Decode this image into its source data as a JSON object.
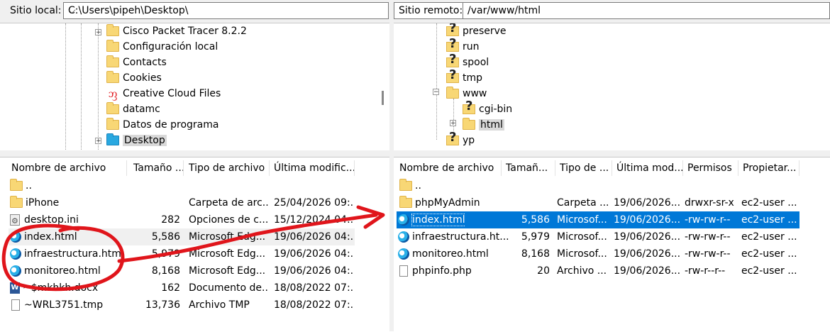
{
  "local": {
    "path_label": "Sitio local:",
    "path_value": "C:\\Users\\pipeh\\Desktop\\",
    "tree": [
      {
        "name": "Cisco Packet Tracer 8.2.2",
        "icon": "folder-icon"
      },
      {
        "name": "Configuración local",
        "icon": "shortcut-folder-icon"
      },
      {
        "name": "Contacts",
        "icon": "folder-icon"
      },
      {
        "name": "Cookies",
        "icon": "shortcut-folder-icon"
      },
      {
        "name": "Creative Cloud Files",
        "icon": "creative-cloud-icon"
      },
      {
        "name": "datamc",
        "icon": "folder-icon"
      },
      {
        "name": "Datos de programa",
        "icon": "shortcut-folder-icon"
      },
      {
        "name": "Desktop",
        "icon": "desktop-folder-icon"
      }
    ],
    "headers": [
      "Nombre de archivo",
      "Tamaño ...",
      "Tipo de archivo",
      "Última modific..."
    ],
    "files": [
      {
        "name": "..",
        "size": "",
        "type": "",
        "modified": "",
        "icon": "folder-icon"
      },
      {
        "name": "iPhone",
        "size": "",
        "type": "Carpeta de arc...",
        "modified": "25/04/2026 09:...",
        "icon": "folder-icon"
      },
      {
        "name": "desktop.ini",
        "size": "282",
        "type": "Opciones de c...",
        "modified": "15/12/2024 04:...",
        "icon": "settings-file-icon"
      },
      {
        "name": "index.html",
        "size": "5,586",
        "type": "Microsoft Edg...",
        "modified": "19/06/2026 04:...",
        "icon": "edge-icon"
      },
      {
        "name": "infraestructura.html",
        "size": "5,979",
        "type": "Microsoft Edg...",
        "modified": "19/06/2026 04:...",
        "icon": "edge-icon"
      },
      {
        "name": "monitoreo.html",
        "size": "8,168",
        "type": "Microsoft Edg...",
        "modified": "19/06/2026 04:...",
        "icon": "edge-icon"
      },
      {
        "name": "~$mkhkh.docx",
        "size": "162",
        "type": "Documento de...",
        "modified": "18/08/2022 07:...",
        "icon": "word-icon"
      },
      {
        "name": "~WRL3751.tmp",
        "size": "13,736",
        "type": "Archivo TMP",
        "modified": "18/08/2022 07:...",
        "icon": "file-icon"
      }
    ]
  },
  "remote": {
    "path_label": "Sitio remoto:",
    "path_value": "/var/www/html",
    "tree": [
      {
        "name": "preserve",
        "icon": "unknown-folder-icon"
      },
      {
        "name": "run",
        "icon": "unknown-folder-icon"
      },
      {
        "name": "spool",
        "icon": "unknown-folder-icon"
      },
      {
        "name": "tmp",
        "icon": "unknown-folder-icon"
      },
      {
        "name": "www",
        "icon": "folder-icon"
      },
      {
        "name": "cgi-bin",
        "icon": "unknown-folder-icon"
      },
      {
        "name": "html",
        "icon": "folder-icon"
      },
      {
        "name": "yp",
        "icon": "unknown-folder-icon"
      }
    ],
    "headers": [
      "Nombre de archivo",
      "Tamañ...",
      "Tipo de ...",
      "Última mod...",
      "Permisos",
      "Propietar..."
    ],
    "files": [
      {
        "name": "..",
        "size": "",
        "type": "",
        "modified": "",
        "perms": "",
        "owner": "",
        "icon": "folder-icon"
      },
      {
        "name": "phpMyAdmin",
        "size": "",
        "type": "Carpeta ...",
        "modified": "19/06/2026...",
        "perms": "drwxr-sr-x",
        "owner": "ec2-user ...",
        "icon": "folder-icon"
      },
      {
        "name": "index.html",
        "size": "5,586",
        "type": "Microsof...",
        "modified": "19/06/2026...",
        "perms": "-rw-rw-r--",
        "owner": "ec2-user ...",
        "icon": "edge-icon"
      },
      {
        "name": "infraestructura.ht...",
        "size": "5,979",
        "type": "Microsof...",
        "modified": "19/06/2026...",
        "perms": "-rw-rw-r--",
        "owner": "ec2-user ...",
        "icon": "edge-icon"
      },
      {
        "name": "monitoreo.html",
        "size": "8,168",
        "type": "Microsof...",
        "modified": "19/06/2026...",
        "perms": "-rw-rw-r--",
        "owner": "ec2-user ...",
        "icon": "edge-icon"
      },
      {
        "name": "phpinfo.php",
        "size": "20",
        "type": "Archivo ...",
        "modified": "19/06/2026...",
        "perms": "-rw-r--r--",
        "owner": "ec2-user ...",
        "icon": "file-icon"
      }
    ]
  },
  "annotation_color": "#e0151b"
}
